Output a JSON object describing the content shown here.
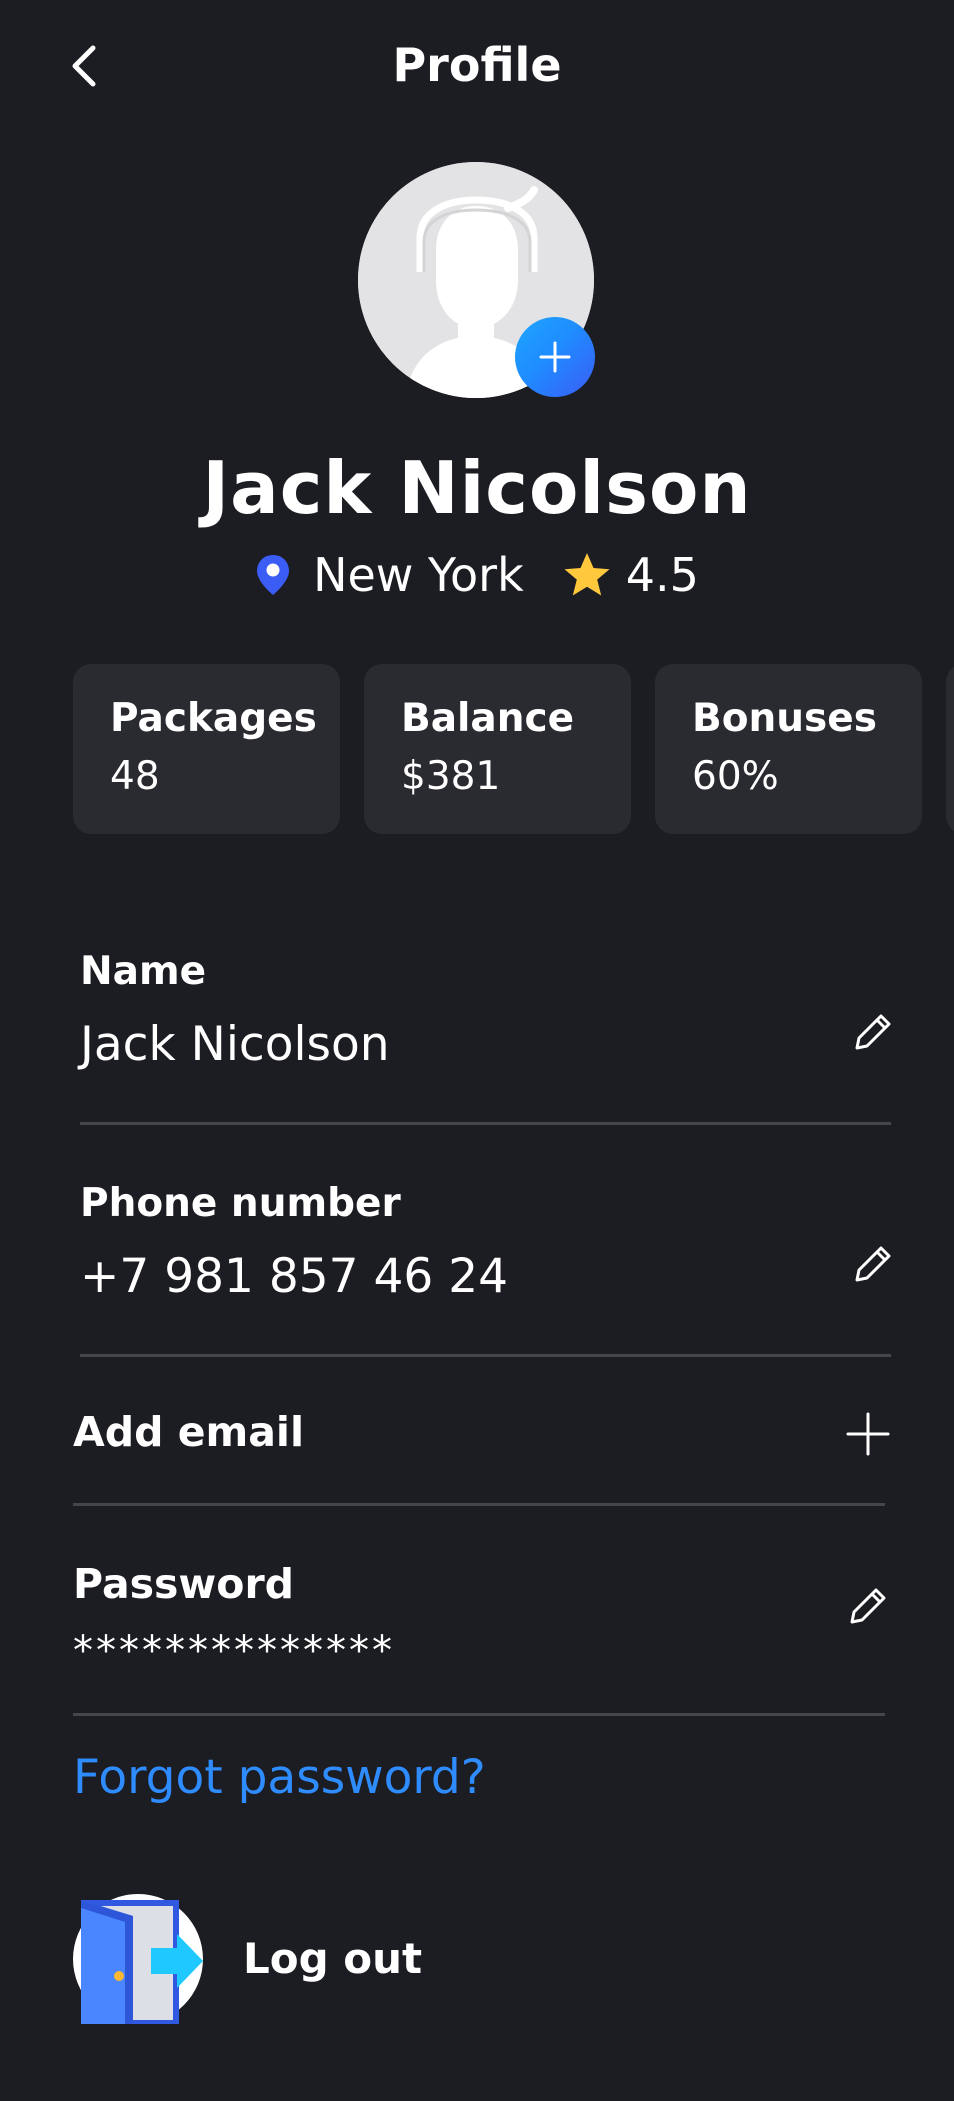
{
  "header": {
    "title": "Profile",
    "back_icon": "chevron-left-icon"
  },
  "profile": {
    "name": "Jack Nicolson",
    "location": "New York",
    "rating": "4.5",
    "location_icon": "location-pin-icon",
    "rating_icon": "star-icon",
    "avatar_icon": "user-avatar-icon",
    "add_photo_icon": "plus-icon"
  },
  "stats": [
    {
      "label": "Packages",
      "value": "48"
    },
    {
      "label": "Balance",
      "value": "$381"
    },
    {
      "label": "Bonuses",
      "value": "60%"
    }
  ],
  "fields": {
    "name": {
      "label": "Name",
      "value": "Jack Nicolson",
      "action_icon": "pencil-icon"
    },
    "phone": {
      "label": "Phone number",
      "value": "+7 981 857 46 24",
      "action_icon": "pencil-icon"
    },
    "email": {
      "label": "Add email",
      "action_icon": "plus-icon"
    },
    "password": {
      "label": "Password",
      "value": "**************",
      "action_icon": "pencil-icon"
    }
  },
  "forgot_password": "Forgot password?",
  "logout": {
    "label": "Log out",
    "icon": "door-exit-icon"
  },
  "colors": {
    "background": "#1c1d22",
    "card": "#2a2b31",
    "divider": "#45464c",
    "link": "#2f8cff",
    "accent_blue": "#3b5cf5",
    "star": "#ffc83d"
  }
}
